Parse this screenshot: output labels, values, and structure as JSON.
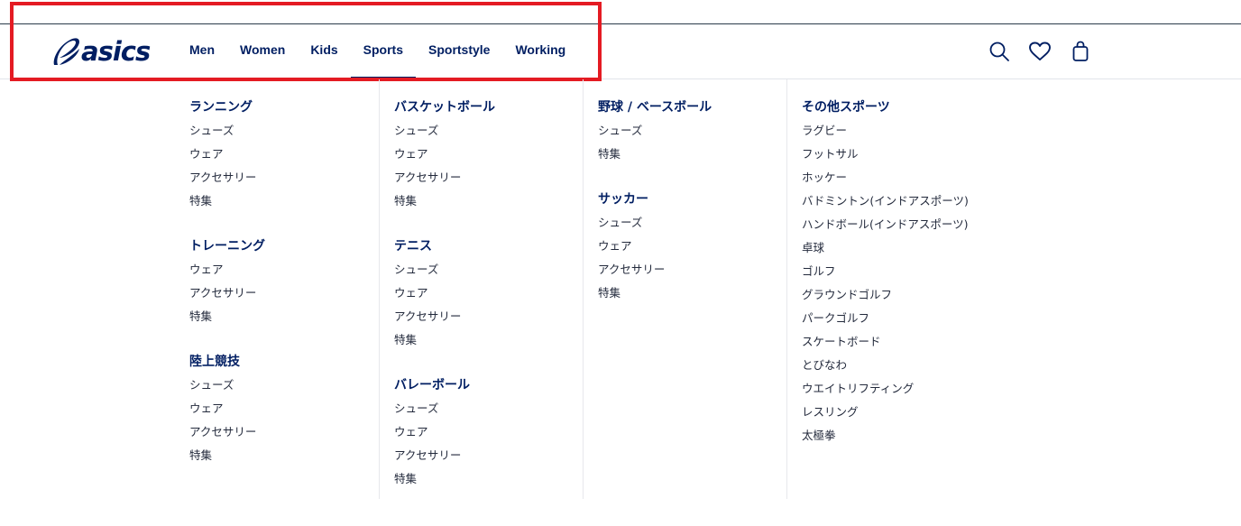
{
  "brand": {
    "logo_text": "asics",
    "color": "#001e62"
  },
  "nav": {
    "items": [
      {
        "label": "Men"
      },
      {
        "label": "Women"
      },
      {
        "label": "Kids"
      },
      {
        "label": "Sports",
        "active": true
      },
      {
        "label": "Sportstyle"
      },
      {
        "label": "Working"
      }
    ]
  },
  "header_icons": [
    "search-icon",
    "heart-icon",
    "bag-icon"
  ],
  "highlight_color": "#e41b23",
  "menu": {
    "columns": [
      {
        "groups": [
          {
            "title": "ランニング",
            "links": [
              "シューズ",
              "ウェア",
              "アクセサリー",
              "特集"
            ]
          },
          {
            "title": "トレーニング",
            "links": [
              "ウェア",
              "アクセサリー",
              "特集"
            ]
          },
          {
            "title": "陸上競技",
            "links": [
              "シューズ",
              "ウェア",
              "アクセサリー",
              "特集"
            ]
          }
        ]
      },
      {
        "groups": [
          {
            "title": "バスケットボール",
            "links": [
              "シューズ",
              "ウェア",
              "アクセサリー",
              "特集"
            ]
          },
          {
            "title": "テニス",
            "links": [
              "シューズ",
              "ウェア",
              "アクセサリー",
              "特集"
            ]
          },
          {
            "title": "バレーボール",
            "links": [
              "シューズ",
              "ウェア",
              "アクセサリー",
              "特集"
            ]
          }
        ]
      },
      {
        "groups": [
          {
            "title": "野球 / ベースボール",
            "links": [
              "シューズ",
              "特集"
            ]
          },
          {
            "title": "サッカー",
            "links": [
              "シューズ",
              "ウェア",
              "アクセサリー",
              "特集"
            ]
          }
        ]
      },
      {
        "groups": [
          {
            "title": "その他スポーツ",
            "links": [
              "ラグビー",
              "フットサル",
              "ホッケー",
              "バドミントン(インドアスポーツ)",
              "ハンドボール(インドアスポーツ)",
              "卓球",
              "ゴルフ",
              "グラウンドゴルフ",
              "パークゴルフ",
              "スケートボード",
              "とびなわ",
              "ウエイトリフティング",
              "レスリング",
              "太極拳"
            ]
          }
        ]
      }
    ]
  }
}
